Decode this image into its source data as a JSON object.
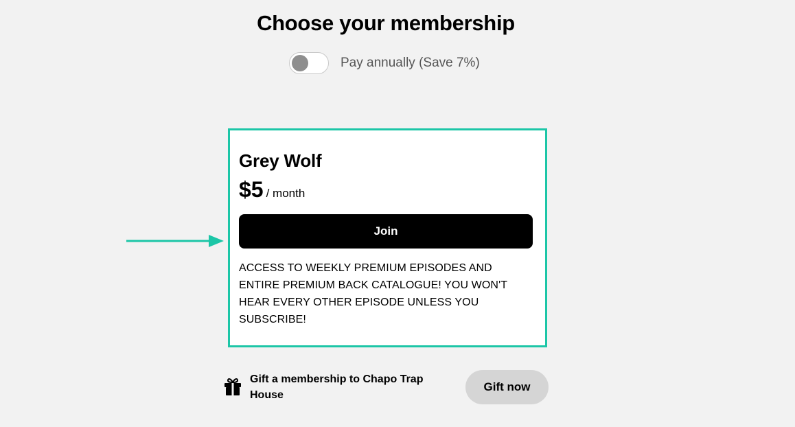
{
  "header": {
    "title": "Choose your membership"
  },
  "billing": {
    "toggle_label": "Pay annually (Save 7%)",
    "annual_enabled": false
  },
  "tier": {
    "name": "Grey Wolf",
    "price": "$5",
    "period": "/ month",
    "join_label": "Join",
    "description": "ACCESS TO WEEKLY PREMIUM EPISODES AND ENTIRE PREMIUM BACK CATALOGUE! YOU WON'T HEAR EVERY OTHER EPISODE UNLESS YOU SUBSCRIBE!"
  },
  "gift": {
    "text": "Gift a membership to Chapo Trap House",
    "button_label": "Gift now",
    "icon": "gift-icon"
  },
  "colors": {
    "accent": "#1cc6a7",
    "background": "#f2f2f2",
    "button": "#000000",
    "gift_button": "#d5d5d5"
  }
}
